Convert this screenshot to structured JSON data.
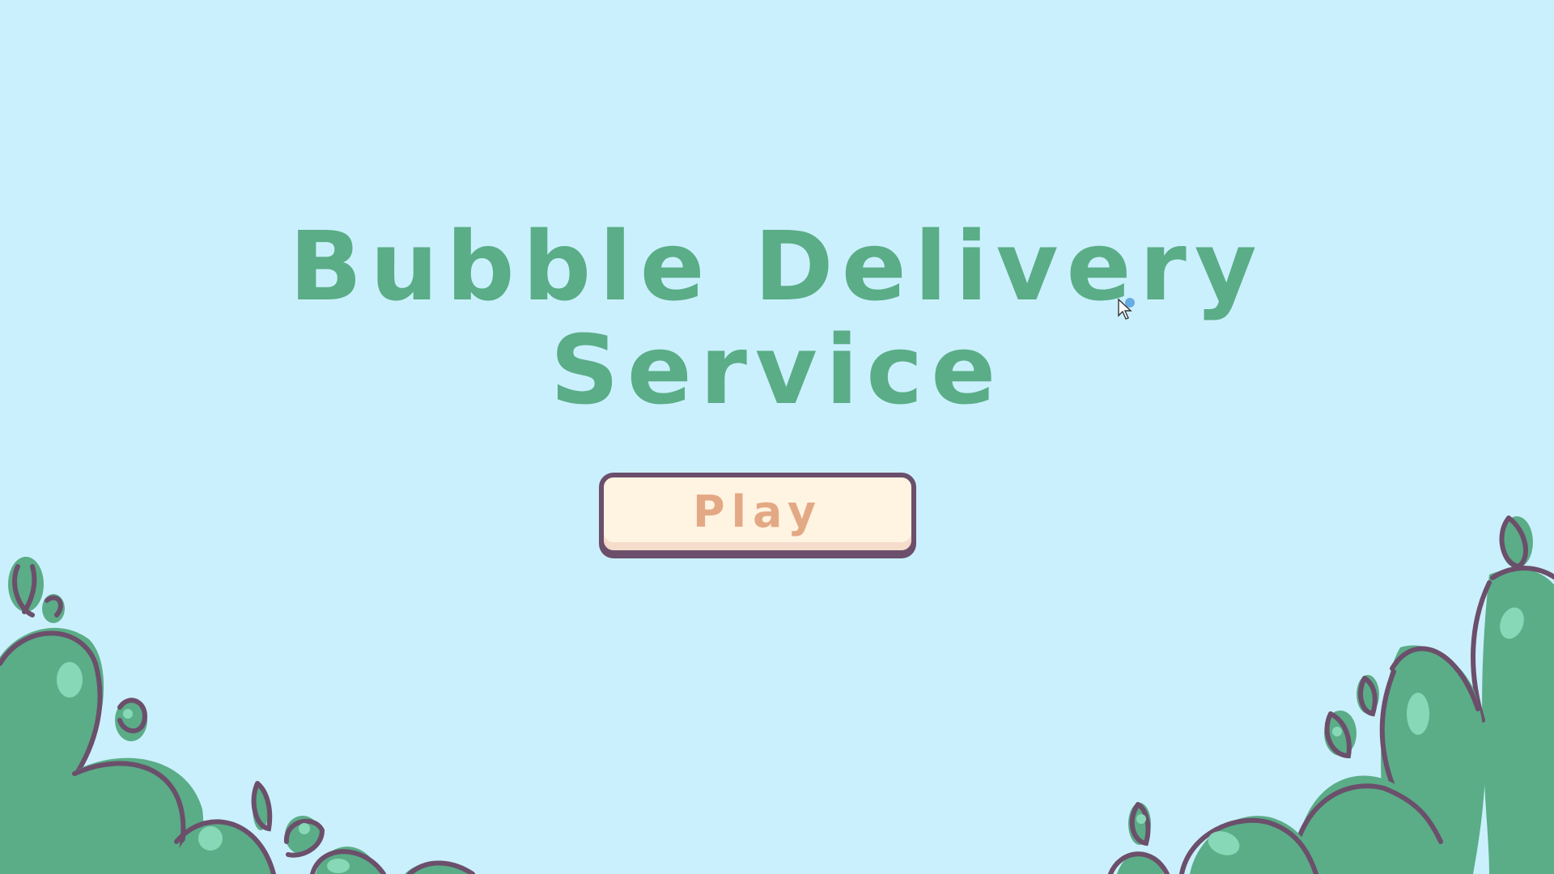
{
  "title": {
    "line1": "Bubble Delivery",
    "line2": "Service"
  },
  "menu": {
    "play_label": "Play"
  },
  "icons": {
    "left_bush": "bush-cluster-left",
    "right_bush": "bush-cluster-right",
    "cursor": "mouse-pointer-icon"
  },
  "colors": {
    "background": "#cbf0fd",
    "title": "#5aad87",
    "button_fill": "#fff4e1",
    "button_border": "#6b4f6b",
    "button_text": "#e3a985",
    "bush_fill": "#5aad87",
    "bush_highlight": "#86d8b6",
    "bush_outline": "#6b4f6b"
  }
}
